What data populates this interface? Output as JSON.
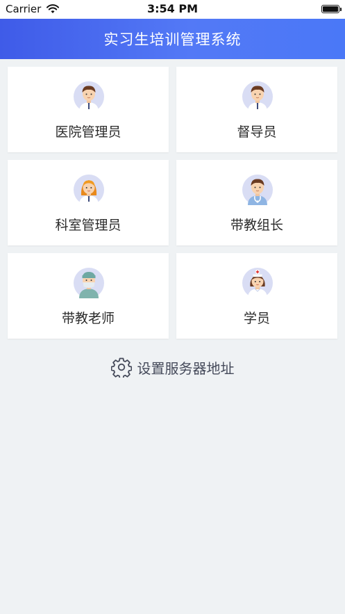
{
  "status_bar": {
    "carrier": "Carrier",
    "time": "3:54 PM"
  },
  "header": {
    "title": "实习生培训管理系统",
    "gradient": [
      "#3f5be8",
      "#4a78f7"
    ]
  },
  "roles": [
    {
      "label": "医院管理员",
      "avatar": "doctor-male-avatar-icon"
    },
    {
      "label": "督导员",
      "avatar": "doctor-male-avatar-icon"
    },
    {
      "label": "科室管理员",
      "avatar": "doctor-female-avatar-icon"
    },
    {
      "label": "带教组长",
      "avatar": "doctor-stethoscope-avatar-icon"
    },
    {
      "label": "带教老师",
      "avatar": "surgeon-avatar-icon"
    },
    {
      "label": "学员",
      "avatar": "nurse-avatar-icon"
    }
  ],
  "settings": {
    "label": "设置服务器地址",
    "icon": "gear-icon"
  },
  "colors": {
    "background": "#eff2f4",
    "avatar_bg": "#d9ddf4",
    "text": "#2b2b2b"
  }
}
